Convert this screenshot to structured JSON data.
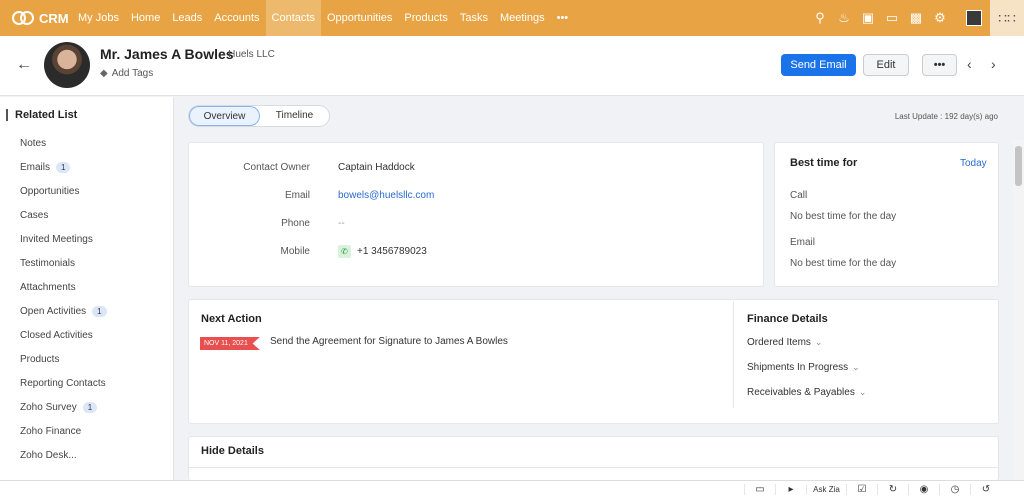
{
  "topnav": {
    "logo": "CRM",
    "tabs": [
      "My Jobs",
      "Home",
      "Leads",
      "Accounts",
      "Contacts",
      "Opportunities",
      "Products",
      "Tasks",
      "Meetings",
      "•••"
    ],
    "active_tab": "Contacts",
    "icons": [
      "search-icon",
      "bell-icon",
      "calendar-add-icon",
      "tablet-icon",
      "store-icon",
      "gear-icon",
      "user-avatar",
      "apps-grid-icon"
    ]
  },
  "header": {
    "back_icon": "←",
    "name": "Mr. James A Bowles",
    "company": "- Huels LLC",
    "add_tags": "Add Tags",
    "send_email": "Send Email",
    "edit": "Edit",
    "more": "•••",
    "prev": "‹",
    "next": "›"
  },
  "sidebar": {
    "title": "Related List",
    "items": [
      {
        "label": "Notes",
        "badge": ""
      },
      {
        "label": "Emails",
        "badge": "1"
      },
      {
        "label": "Opportunities",
        "badge": ""
      },
      {
        "label": "Cases",
        "badge": ""
      },
      {
        "label": "Invited Meetings",
        "badge": ""
      },
      {
        "label": "Testimonials",
        "badge": ""
      },
      {
        "label": "Attachments",
        "badge": ""
      },
      {
        "label": "Open Activities",
        "badge": "1"
      },
      {
        "label": "Closed Activities",
        "badge": ""
      },
      {
        "label": "Products",
        "badge": ""
      },
      {
        "label": "Reporting Contacts",
        "badge": ""
      },
      {
        "label": "Zoho Survey",
        "badge": "1"
      },
      {
        "label": "Zoho Finance",
        "badge": ""
      },
      {
        "label": "Zoho Desk...",
        "badge": ""
      }
    ]
  },
  "main": {
    "toggle": {
      "overview": "Overview",
      "timeline": "Timeline"
    },
    "last_update": "Last Update : 192 day(s) ago",
    "details": {
      "owner_label": "Contact Owner",
      "owner_value": "Captain Haddock",
      "email_label": "Email",
      "email_value": "bowels@huelsllc.com",
      "phone_label": "Phone",
      "phone_value": "--",
      "mobile_label": "Mobile",
      "mobile_value": "+1 3456789023"
    },
    "best_time": {
      "title": "Best time for",
      "today": "Today",
      "call_label": "Call",
      "call_value": "No best time for the day",
      "email_label": "Email",
      "email_value": "No best time for the day"
    },
    "next_action": {
      "title": "Next Action",
      "date": "NOV 11, 2021",
      "text": "Send the Agreement for Signature to James A Bowles"
    },
    "finance": {
      "title": "Finance Details",
      "items": [
        "Ordered Items",
        "Shipments In Progress",
        "Receivables & Payables"
      ]
    },
    "hide_details": "Hide Details"
  },
  "bottombar": {
    "ask_zia": "Ask Zia"
  }
}
